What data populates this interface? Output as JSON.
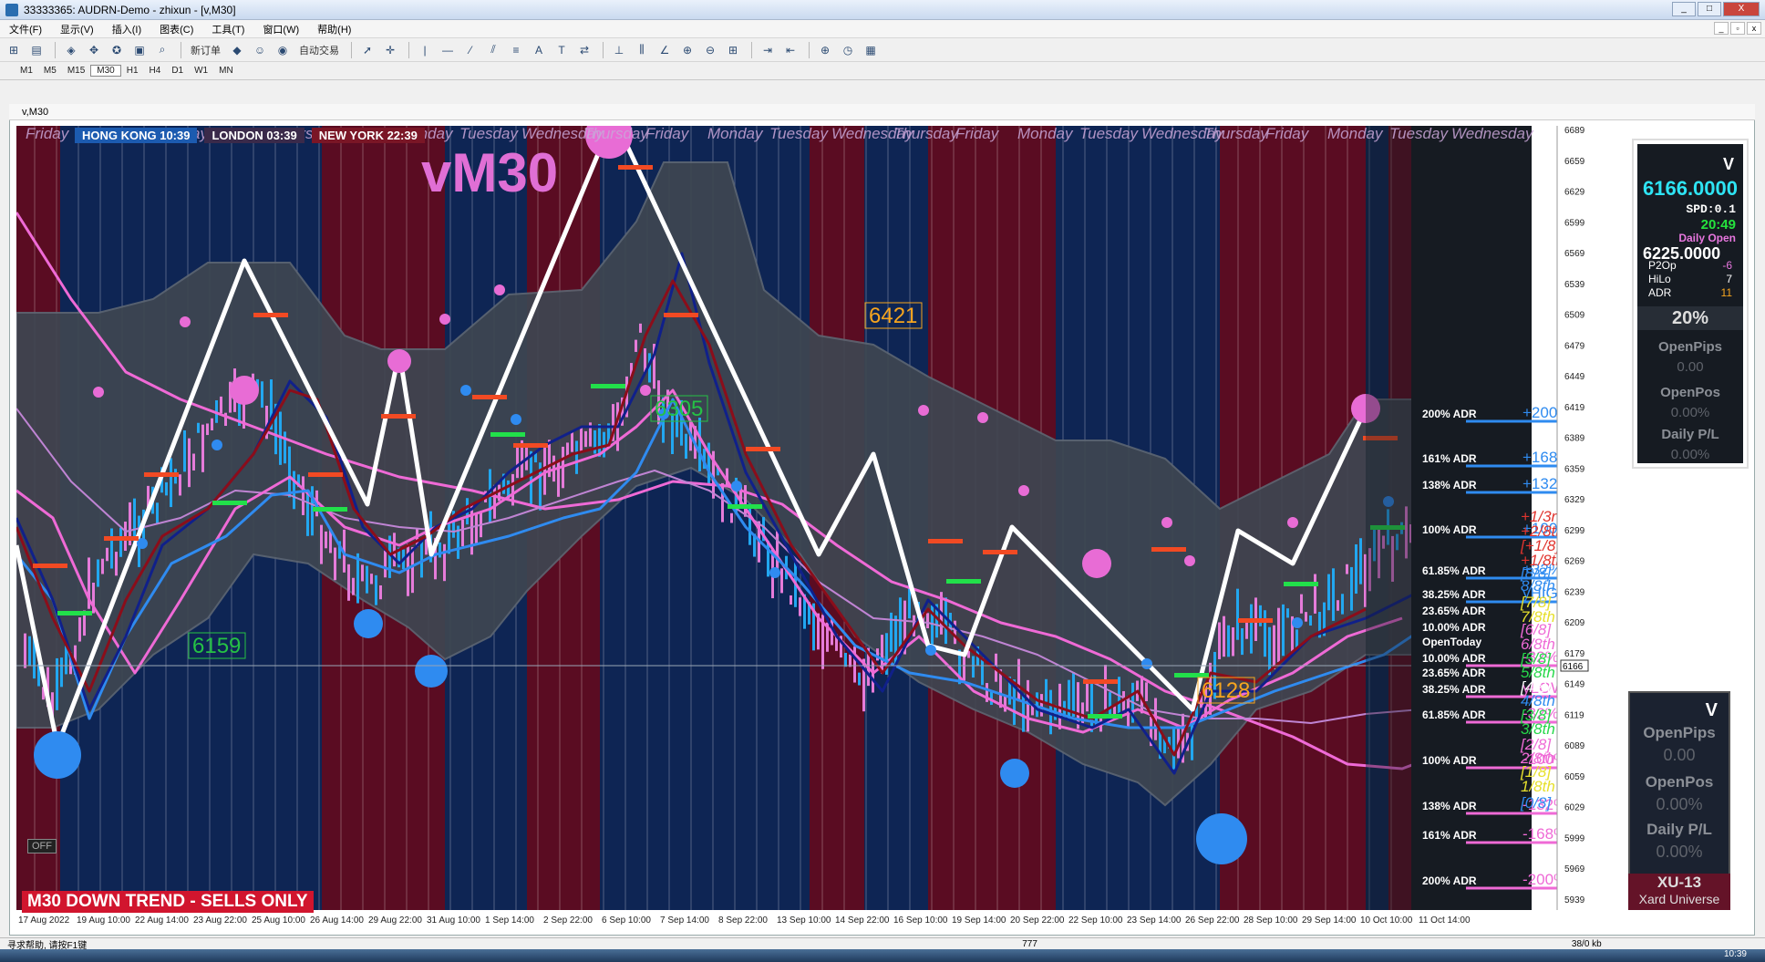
{
  "window": {
    "title": "33333365: AUDRN-Demo - zhixun - [v,M30]",
    "controls": [
      "_",
      "□",
      "X"
    ]
  },
  "menu": {
    "items": [
      "文件(F)",
      "显示(V)",
      "插入(I)",
      "图表(C)",
      "工具(T)",
      "窗口(W)",
      "帮助(H)"
    ]
  },
  "toolbar": {
    "new_order": "新订单",
    "auto_trading": "自动交易"
  },
  "timeframes": [
    "M1",
    "M5",
    "M15",
    "M30",
    "H1",
    "H4",
    "D1",
    "W1",
    "MN"
  ],
  "active_timeframe": "M30",
  "chart_window_title": "v,M30",
  "sessions": {
    "hongkong": "HONG KONG 10:39",
    "london": "LONDON  03:39",
    "newyork": "NEW YORK 22:39"
  },
  "header_days": [
    "Friday",
    "Monday",
    "Tuesday",
    "Wednesday",
    "Thursday",
    "Friday",
    "Monday",
    "Tuesday",
    "Wednesday",
    "Thursday",
    "Friday",
    "Monday",
    "Tuesday",
    "Wednesday",
    "Thursday",
    "Friday",
    "Monday",
    "Tuesday",
    "Wednesday",
    "Thursday",
    "Friday",
    "Monday",
    "Tuesday",
    "Wednesday"
  ],
  "big_label": "vM30",
  "trend_banner": "M30  DOWN TREND - SELLS ONLY",
  "off_button": "OFF",
  "price_labels": {
    "p6421": "6421",
    "p6305": "6305",
    "p6159": "6159",
    "p6128": "6128"
  },
  "price_scale": [
    "6689",
    "6659",
    "6629",
    "6599",
    "6569",
    "6539",
    "6509",
    "6479",
    "6449",
    "6419",
    "6389",
    "6359",
    "6329",
    "6299",
    "6269",
    "6239",
    "6209",
    "6179",
    "6149",
    "6119",
    "6089",
    "6059",
    "6029",
    "5999",
    "5969",
    "5939"
  ],
  "current_price_tag": "6166",
  "time_axis": [
    "17 Aug 2022",
    "19 Aug 10:00",
    "22 Aug 14:00",
    "23 Aug 22:00",
    "25 Aug 10:00",
    "26 Aug 14:00",
    "29 Aug 22:00",
    "31 Aug 10:00",
    "1 Sep 14:00",
    "2 Sep 22:00",
    "6 Sep 10:00",
    "7 Sep 14:00",
    "8 Sep 22:00",
    "13 Sep 10:00",
    "14 Sep 22:00",
    "16 Sep 10:00",
    "19 Sep 14:00",
    "20 Sep 22:00",
    "22 Sep 10:00",
    "23 Sep 14:00",
    "26 Sep 22:00",
    "28 Sep 10:00",
    "29 Sep 14:00",
    "10 Oct 10:00",
    "11 Oct 14:00"
  ],
  "adr_levels": [
    {
      "label": "200% ADR",
      "pct": "+200%",
      "pct_color": "#2f8bf0"
    },
    {
      "label": "161% ADR",
      "pct": "+168%",
      "pct_color": "#2f8bf0"
    },
    {
      "label": "138% ADR",
      "pct": "+132%",
      "pct_color": "#2f8bf0"
    },
    {
      "label": "100% ADR",
      "pct": "+100%",
      "pct_color": "#2f8bf0"
    },
    {
      "label": "61.85% ADR",
      "pct": "+32%",
      "pct_color": "#2f8bf0"
    },
    {
      "label": "38.25% ADR",
      "pct": "yHIGH",
      "pct_color": "#2f8bf0"
    },
    {
      "label": "23.65% ADR",
      "pct": "",
      "pct_color": "#2f8bf0"
    },
    {
      "label": "10.00% ADR",
      "pct": "",
      "pct_color": "#2f8bf0"
    },
    {
      "label": "OpenToday",
      "pct": "",
      "pct_color": "#fff"
    },
    {
      "label": "10.00% ADR",
      "pct": "-32%",
      "pct_color": "#ef6ad6"
    },
    {
      "label": "23.65% ADR",
      "pct": "",
      "pct_color": "#ef6ad6"
    },
    {
      "label": "38.25% ADR",
      "pct": "yLOW",
      "pct_color": "#ef6ad6"
    },
    {
      "label": "61.85% ADR",
      "pct": "-32%",
      "pct_color": "#ef6ad6"
    },
    {
      "label": "100% ADR",
      "pct": "-100%",
      "pct_color": "#ef6ad6"
    },
    {
      "label": "138% ADR",
      "pct": "-132%",
      "pct_color": "#ef6ad6"
    },
    {
      "label": "161% ADR",
      "pct": "-168%",
      "pct_color": "#ef6ad6"
    },
    {
      "label": "200% ADR",
      "pct": "-200%",
      "pct_color": "#ef6ad6"
    }
  ],
  "murrey": [
    {
      "label": "+1/3rd",
      "color": "#e0342e"
    },
    {
      "label": "+2/8th",
      "color": "#e0342e"
    },
    {
      "label": "[+1/8]",
      "color": "#e0342e"
    },
    {
      "label": "+1/8th",
      "color": "#e0342e"
    },
    {
      "label": "[8/8]",
      "color": "#2f8bf0"
    },
    {
      "label": "8/8th",
      "color": "#2f8bf0"
    },
    {
      "label": "[7/8]",
      "color": "#e7e02d"
    },
    {
      "label": "7/8th",
      "color": "#e7e02d"
    },
    {
      "label": "[6/8]",
      "color": "#ef6ad6"
    },
    {
      "label": "6/8th",
      "color": "#ef6ad6"
    },
    {
      "label": "[5/8]",
      "color": "#26d84a"
    },
    {
      "label": "5/8th",
      "color": "#26d84a"
    },
    {
      "label": "[4/8]",
      "color": "#ffffff"
    },
    {
      "label": "4/8th",
      "color": "#2f8bf0"
    },
    {
      "label": "[3/8]",
      "color": "#26d84a"
    },
    {
      "label": "3/8th",
      "color": "#26d84a"
    },
    {
      "label": "[2/8]",
      "color": "#ef6ad6"
    },
    {
      "label": "2/8th",
      "color": "#ef6ad6"
    },
    {
      "label": "[1/8]",
      "color": "#e7e02d"
    },
    {
      "label": "1/8th",
      "color": "#e7e02d"
    },
    {
      "label": "[0/8]",
      "color": "#2f8bf0"
    }
  ],
  "infobox": {
    "v": "V",
    "price": "6166.0000",
    "spd": "SPD:0.1",
    "time": "20:49",
    "daily_open_label": "Daily Open",
    "daily_open": "6225.0000",
    "p2op_label": "P2Op",
    "p2op": "-6",
    "hilo_label": "HiLo",
    "hilo": "7",
    "adr_label": "ADR",
    "adr": "11",
    "pct": "20%",
    "openpips_label": "OpenPips",
    "openpips": "0.00",
    "openpos_label": "OpenPos",
    "openpos": "0.00%",
    "dailypl_label": "Daily P/L",
    "dailypl": "0.00%"
  },
  "infobox2": {
    "v": "V",
    "openpips_label": "OpenPips",
    "openpips": "0.00",
    "openpos_label": "OpenPos",
    "openpos": "0.00%",
    "dailypl_label": "Daily P/L",
    "dailypl": "0.00%"
  },
  "branding": {
    "line1": "XU-13",
    "line2": "Xard Universe"
  },
  "status": {
    "help": "寻求帮助, 请按F1键",
    "mid": "777",
    "right": "38/0 kb"
  },
  "clock": "10:39",
  "colors": {
    "bg_red": "#5a0c22",
    "bg_blue": "#0e2554",
    "bg_dark": "#161b22",
    "channel": "#3e4651",
    "zigzag": "#ffffff",
    "ma_pink": "#ef6ad6",
    "ma_blue": "#2f8bf0",
    "ma_darkred": "#8b0d1a",
    "ma_navy": "#10208a"
  }
}
